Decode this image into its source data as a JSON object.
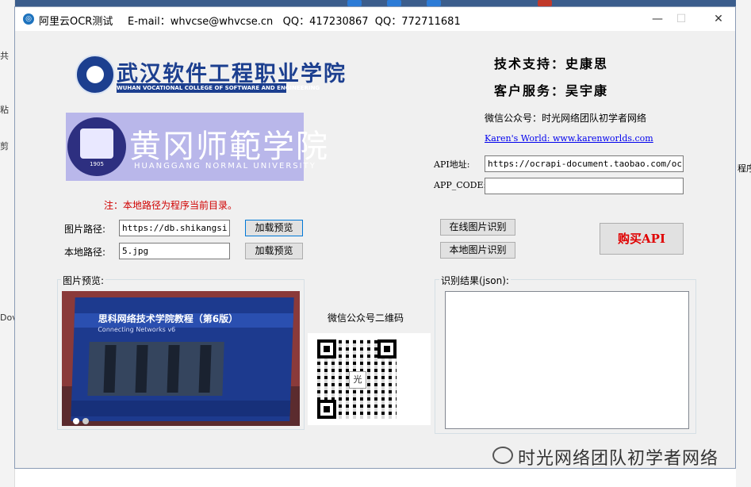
{
  "window": {
    "title": "阿里云OCR测试",
    "info": "E-mail：whvcse@whvcse.cn   QQ：417230867  QQ：772711681",
    "minimize_glyph": "—",
    "maximize_glyph": "☐",
    "close_glyph": "✕"
  },
  "background": {
    "left_texts": [
      "共",
      "粘",
      "剪",
      "Dov"
    ],
    "right_text": "程序"
  },
  "logos": {
    "whvcse_cn": "武汉软件工程职业学院",
    "whvcse_en": "WUHAN VOCATIONAL COLLEGE OF SOFTWARE AND ENGINEERING",
    "hgnu_cn": "黄冈师範学院",
    "hgnu_en": "HUANGGANG NORMAL UNIVERSITY",
    "hgnu_year": "1905"
  },
  "support": {
    "tech": "技术支持：史康思",
    "service": "客户服务：吴宇康",
    "wechat": "微信公众号：时光网络团队初学者网络",
    "website_link": "Karen's World: www.karenworlds.com"
  },
  "api": {
    "url_label": "API地址:",
    "url_value": "https://ocrapi-document.taobao.com/ocrser",
    "code_label": "APP_CODE:",
    "code_value": ""
  },
  "note": "注：本地路径为程序当前目录。",
  "form": {
    "image_path_label": "图片路径:",
    "image_path_value": "https://db.shikangsi.c",
    "load_preview_1": "加载预览",
    "local_path_label": "本地路径:",
    "local_path_value": "5.jpg",
    "load_preview_2": "加载预览",
    "online_ocr": "在线图片识别",
    "local_ocr": "本地图片识别",
    "buy_api": "购买API"
  },
  "preview": {
    "legend": "图片预览:",
    "book_title": "思科网络技术学院教程（第6版）",
    "book_subtitle": "Connecting Networks v6"
  },
  "qr": {
    "caption": "微信公众号二维码",
    "center_char": "光"
  },
  "result": {
    "legend": "识别结果(json):",
    "text": ""
  },
  "watermark": "时光网络团队初学者网络",
  "colors": {
    "link": "#0000ee",
    "note": "#d00000",
    "buy": "#e00000",
    "logo_blue": "#1c3f8f",
    "logo_purple": "#b9b7ea"
  }
}
